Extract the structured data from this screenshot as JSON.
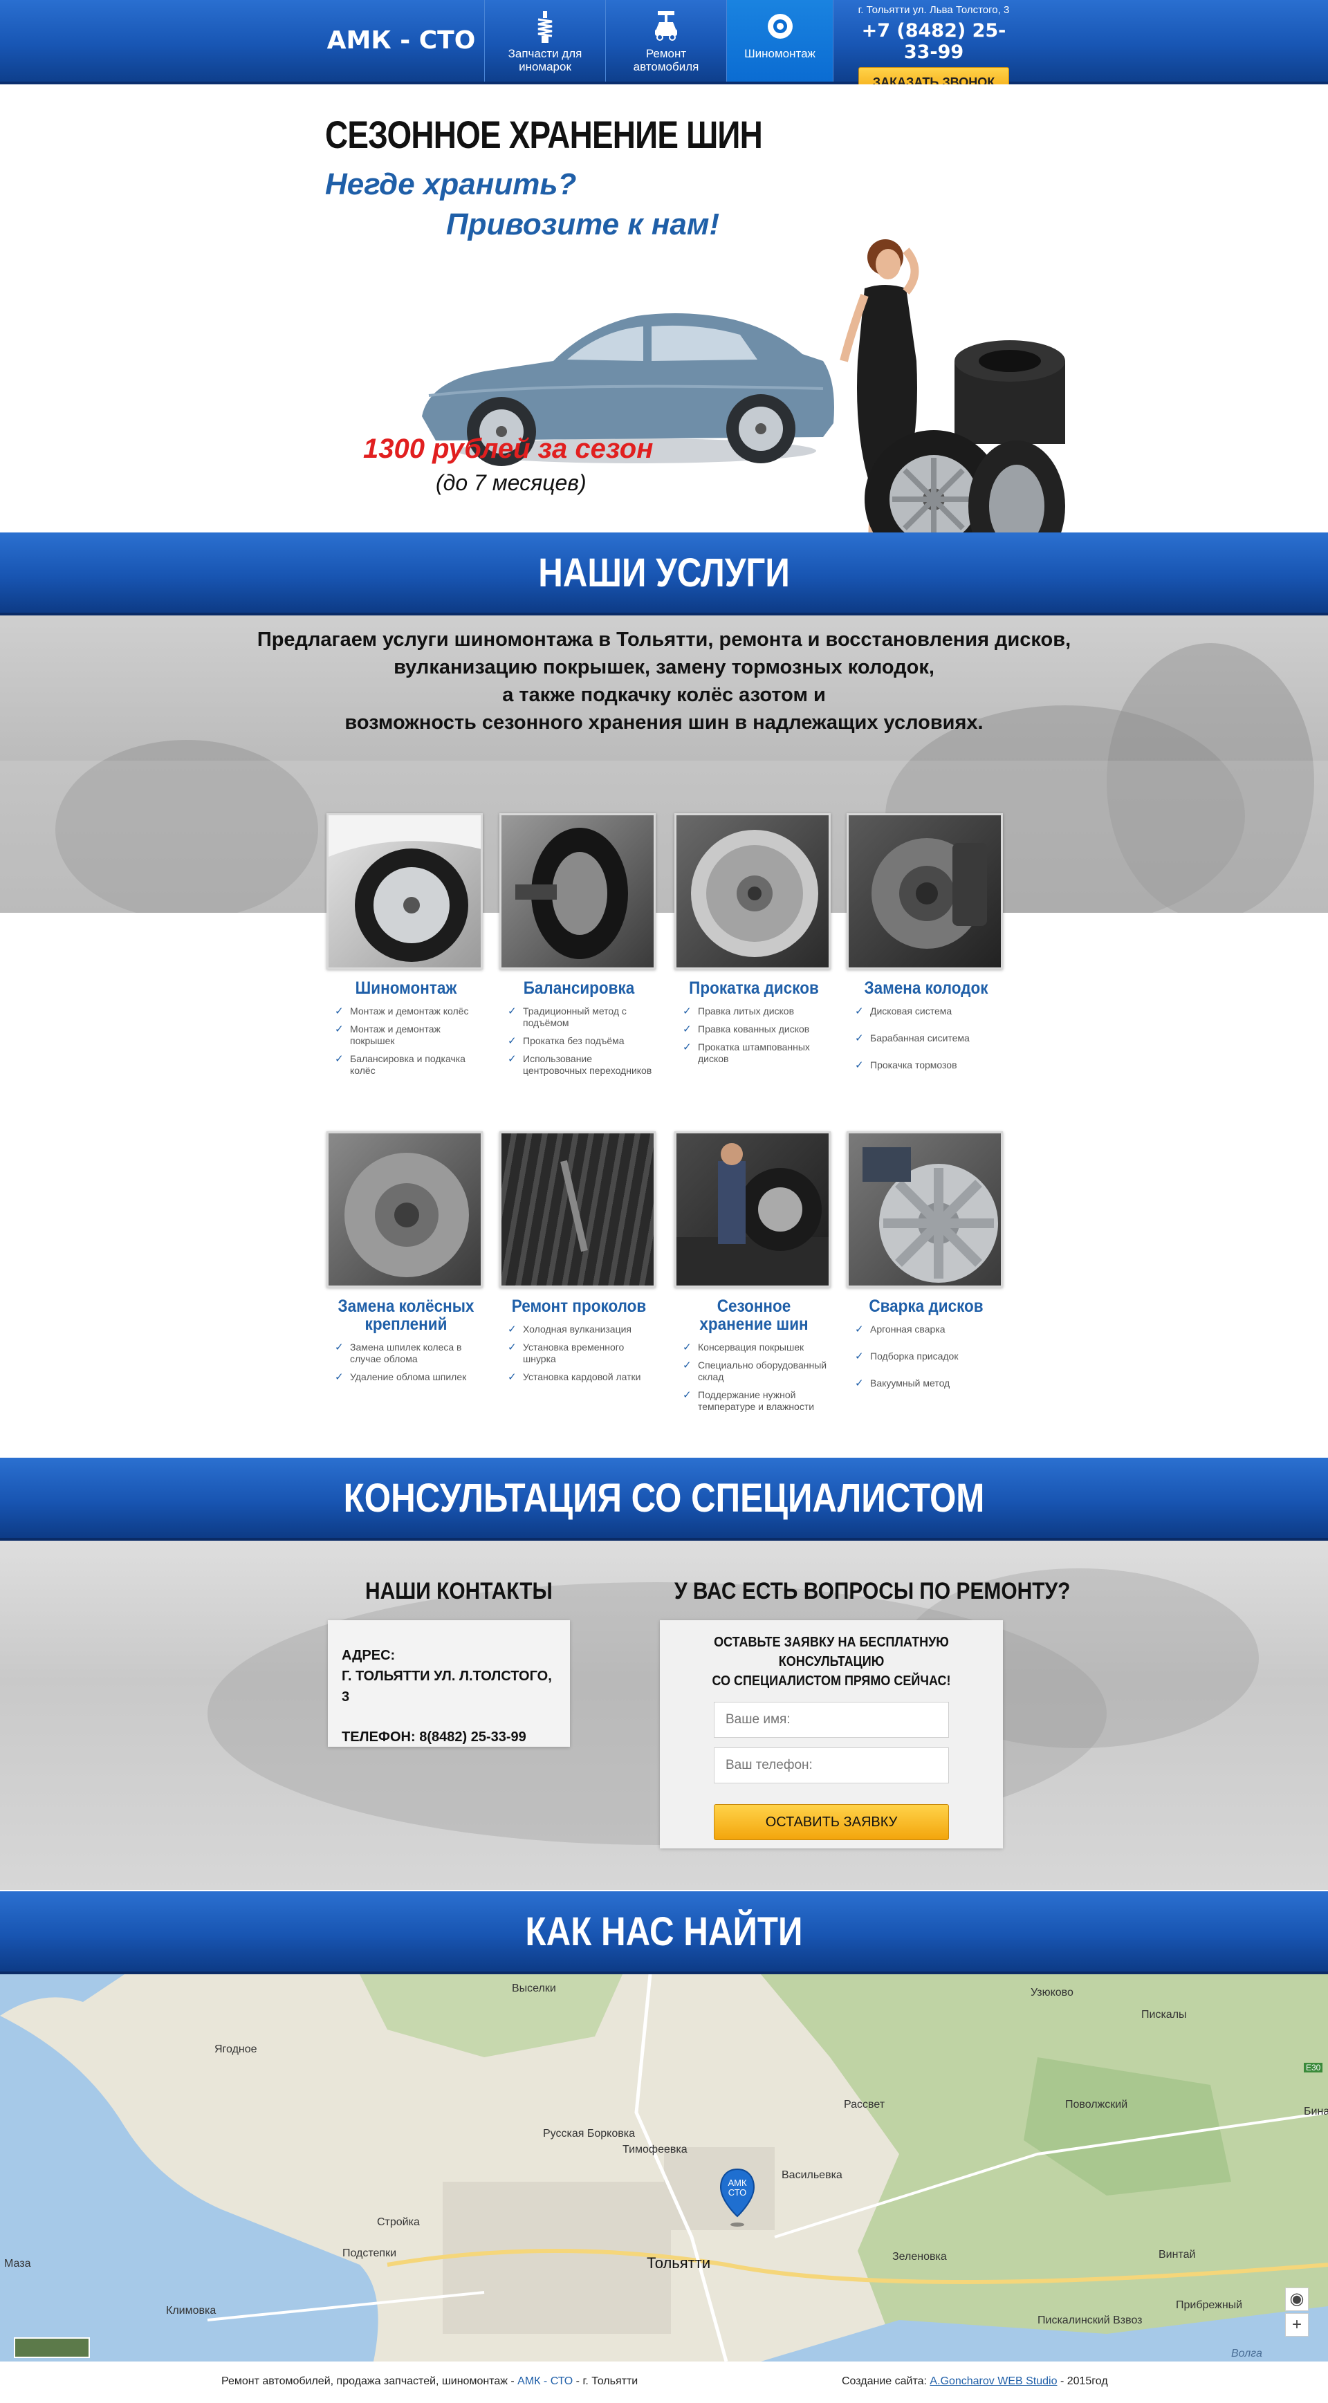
{
  "header": {
    "logo": "АМК - СТО",
    "nav": [
      {
        "label": "Запчасти для иномарок",
        "icon": "shock-absorber-icon"
      },
      {
        "label": "Ремонт автомобиля",
        "icon": "car-lift-icon"
      },
      {
        "label": "Шиномонтаж",
        "icon": "tire-icon"
      }
    ],
    "address": "г. Тольятти ул. Льва Толстого, 3",
    "phone": "+7 (8482) 25-33-99",
    "call_button": "ЗАКАЗАТЬ ЗВОНОК"
  },
  "hero": {
    "title": "СЕЗОННОЕ ХРАНЕНИЕ ШИН",
    "question": "Негде хранить?",
    "answer": "Привозите к нам!",
    "price": "1300 рублей за сезон",
    "period": "(до 7 месяцев)"
  },
  "services": {
    "heading": "НАШИ УСЛУГИ",
    "intro": [
      "Предлагаем услуги шиномонтажа в Тольятти, ремонта и восстановления дисков,",
      "вулканизацию покрышек, замену тормозных колодок,",
      "а также подкачку колёс азотом и",
      "возможность сезонного хранения шин в надлежащих условиях."
    ],
    "cards": [
      {
        "title": "Шиномонтаж",
        "items": [
          "Монтаж и демонтаж колёс",
          "Монтаж и демонтаж покрышек",
          "Балансировка и подкачка колёс"
        ]
      },
      {
        "title": "Балансировка",
        "items": [
          "Традиционный метод с подъёмом",
          "Прокатка без подъёма",
          "Использование центровочных переходников"
        ]
      },
      {
        "title": "Прокатка дисков",
        "items": [
          "Правка литых дисков",
          "Правка кованных дисков",
          "Прокатка штампованных дисков"
        ]
      },
      {
        "title": "Замена колодок",
        "items": [
          "Дисковая система",
          "Барабанная сиситема",
          "Прокачка тормозов"
        ]
      },
      {
        "title": "Замена колёсных креплений",
        "items": [
          "Замена шпилек колеса в случае облома",
          "Удаление облома шпилек"
        ]
      },
      {
        "title": "Ремонт проколов",
        "items": [
          "Холодная вулканизация",
          "Установка временного шнурка",
          "Установка кардовой латки"
        ]
      },
      {
        "title": "Сезонное хранение шин",
        "items": [
          "Консервация покрышек",
          "Специально оборудованный склад",
          "Поддержание нужной температуре и влажности"
        ]
      },
      {
        "title": "Сварка дисков",
        "items": [
          "Аргонная сварка",
          "Подборка присадок",
          "Вакуумный метод"
        ]
      }
    ]
  },
  "consult": {
    "heading": "КОНСУЛЬТАЦИЯ СО СПЕЦИАЛИСТОМ",
    "contacts_title": "НАШИ КОНТАКТЫ",
    "address_label": "АДРЕС:",
    "address_value": "Г. ТОЛЬЯТТИ УЛ. Л.ТОЛСТОГО, 3",
    "phone_line": "ТЕЛЕФОН: 8(8482) 25-33-99",
    "questions_title": "У ВАС ЕСТЬ ВОПРОСЫ ПО РЕМОНТУ?",
    "form_lead_1": "ОСТАВЬТЕ ЗАЯВКУ НА БЕСПЛАТНУЮ КОНСУЛЬТАЦИЮ",
    "form_lead_2": "СО СПЕЦИАЛИСТОМ ПРЯМО СЕЙЧАС!",
    "name_placeholder": "Ваше имя:",
    "phone_placeholder": "Ваш телефон:",
    "submit": "ОСТАВИТЬ ЗАЯВКУ"
  },
  "map": {
    "heading": "КАК НАС НАЙТИ",
    "pin": "АМК СТО",
    "labels": [
      "Выселки",
      "Узюково",
      "Пискалы",
      "Ягодное",
      "Рассвет",
      "Поволжский",
      "Русская Борковка",
      "Тимофеевка",
      "Васильевка",
      "Стройка",
      "Подстепки",
      "Тольятти",
      "Зеленовка",
      "Винтай",
      "Климовка",
      "Пискалинский Взвоз",
      "Прибрежный",
      "Маза",
      "Бина",
      "Е30",
      "Волга"
    ],
    "zoom_in": "+",
    "locate": "◉"
  },
  "footer": {
    "left_prefix": "Ремонт автомобилей, продажа запчастей, шиномонтаж -",
    "left_brand": "АМК - СТО",
    "left_suffix": "- г. Тольятти",
    "right_prefix": "Создание сайта:",
    "right_link": "A.Goncharov WEB Studio",
    "right_suffix": "- 2015год"
  },
  "colors": {
    "brand_blue": "#1856b4",
    "accent_yellow": "#f3a50c",
    "price_red": "#e11f1f",
    "title_blue": "#1f5fa8"
  }
}
